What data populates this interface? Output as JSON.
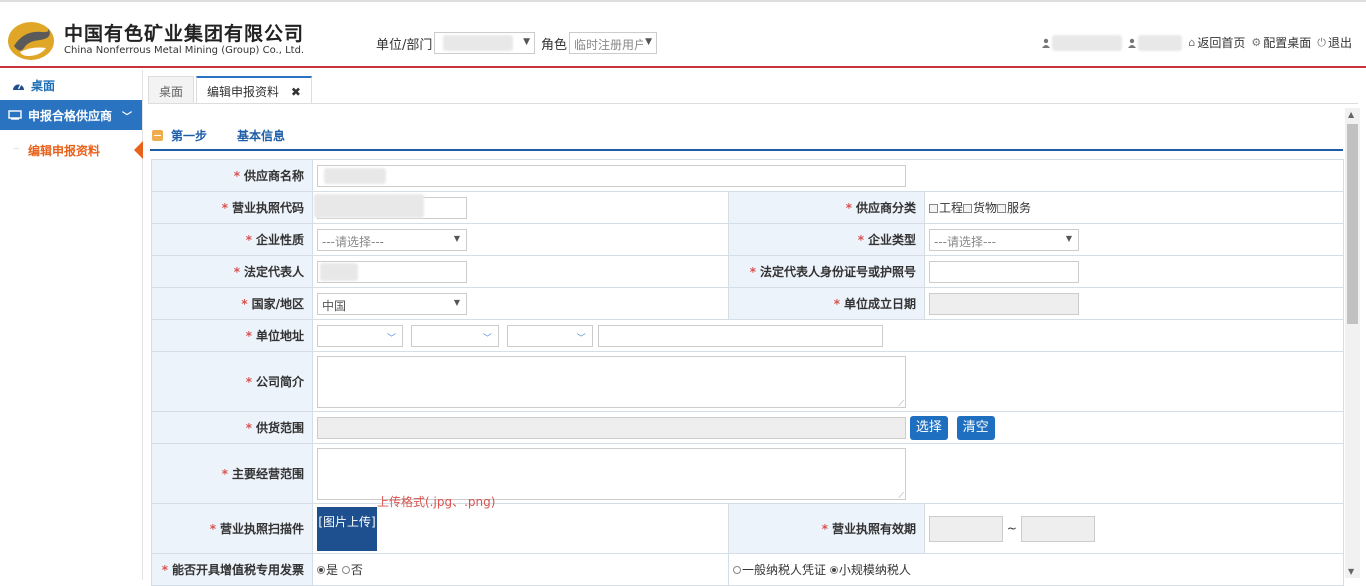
{
  "header": {
    "company_cn": "中国有色矿业集团有限公司",
    "company_en": "China Nonferrous Metal Mining (Group) Co., Ltd.",
    "unit_label": "单位/部门",
    "role_label": "角色",
    "role_value": "临时注册用户",
    "links": [
      {
        "icon": "home-icon",
        "label": "返回首页"
      },
      {
        "icon": "gear-icon",
        "label": "配置桌面"
      },
      {
        "icon": "power-icon",
        "label": "退出"
      }
    ]
  },
  "sidebar": {
    "desk": "桌面",
    "menu": "申报合格供应商",
    "sub": "编辑申报资料"
  },
  "tabs": [
    {
      "label": "桌面"
    },
    {
      "label": "编辑申报资料",
      "close": "✖"
    }
  ],
  "step": {
    "label": "第一步",
    "title": "基本信息"
  },
  "form": {
    "supplier_name": "供应商名称",
    "license_code": "营业执照代码",
    "supplier_class": "供应商分类",
    "class_options": [
      "工程",
      "货物",
      "服务"
    ],
    "enterprise_nature": "企业性质",
    "enterprise_type": "企业类型",
    "select_placeholder": "---请选择---",
    "legal_rep": "法定代表人",
    "legal_rep_id": "法定代表人身份证号或护照号",
    "country": "国家/地区",
    "country_value": "中国",
    "founded_date": "单位成立日期",
    "address": "单位地址",
    "intro": "公司简介",
    "supply_scope": "供货范围",
    "btn_select": "选择",
    "btn_clear": "清空",
    "main_scope": "主要经营范围",
    "license_scan": "营业执照扫描件",
    "upload_btn": "[图片上传]",
    "upload_hint": "上传格式(.jpg、.png)",
    "license_valid": "营业执照有效期",
    "range_sep": "~",
    "vat_invoice": "能否开具增值税专用发票",
    "vat_yes": "是",
    "vat_no": "否",
    "tax_general": "一般纳税人凭证",
    "tax_small": "小规模纳税人"
  }
}
